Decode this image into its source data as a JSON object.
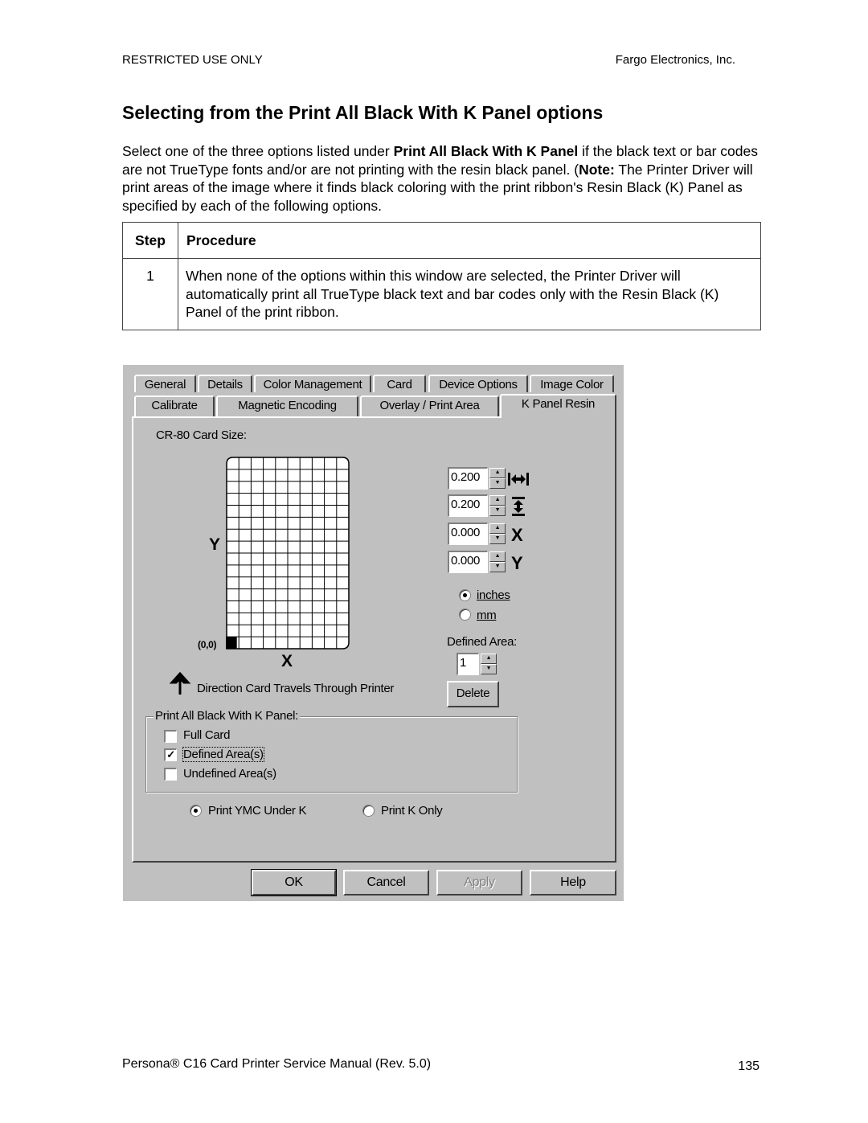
{
  "header": {
    "left": "RESTRICTED USE ONLY",
    "right": "Fargo Electronics, Inc."
  },
  "section_title": "Selecting from the Print All Black With K Panel options",
  "intro": {
    "part1": "Select one of the three options listed under ",
    "bold1": "Print All Black With K Panel",
    "part2": " if the black text or bar codes are not TrueType fonts and/or are not printing with the resin black panel. (",
    "bold2": "Note:",
    "part3": " The Printer Driver will print areas of the image where it finds black coloring with the print ribbon's Resin Black (K) Panel as specified by each of the following options."
  },
  "procedure_table": {
    "columns": [
      "Step",
      "Procedure"
    ],
    "rows": [
      {
        "step": "1",
        "procedure": "When none of the options within this window are selected, the Printer Driver will automatically print all TrueType black text and bar codes only with the Resin Black (K) Panel of the print ribbon."
      }
    ]
  },
  "dialog": {
    "tabs_row1": [
      "General",
      "Details",
      "Color Management",
      "Card",
      "Device Options",
      "Image Color"
    ],
    "tabs_row2": [
      "Calibrate",
      "Magnetic Encoding",
      "Overlay / Print Area",
      "K Panel Resin"
    ],
    "active_tab": "K Panel Resin",
    "card_size_label": "CR-80 Card Size:",
    "grid": {
      "columns": 10,
      "rows": 16
    },
    "axis_y_label": "Y",
    "axis_x_label": "X",
    "origin_label": "(0,0)",
    "direction_label": "Direction Card Travels Through Printer",
    "spinners": [
      {
        "name": "width",
        "value": "0.200",
        "icon": "width-arrows-icon"
      },
      {
        "name": "height",
        "value": "0.200",
        "icon": "height-arrows-icon"
      },
      {
        "name": "x",
        "value": "0.000",
        "icon": "x-icon"
      },
      {
        "name": "y",
        "value": "0.000",
        "icon": "y-icon"
      }
    ],
    "spinner_icon_glyphs": {
      "x": "X",
      "y": "Y"
    },
    "units": {
      "options": [
        "inches",
        "mm"
      ],
      "selected": "inches"
    },
    "defined_area_label": "Defined Area:",
    "defined_area_value": "1",
    "delete_label": "Delete",
    "group_title": "Print All Black With K Panel:",
    "checkboxes": [
      {
        "label": "Full Card",
        "checked": false
      },
      {
        "label": "Defined Area(s)",
        "checked": true
      },
      {
        "label": "Undefined Area(s)",
        "checked": false
      }
    ],
    "print_mode": {
      "options": [
        "Print YMC Under K",
        "Print K Only"
      ],
      "selected": "Print YMC Under K"
    },
    "buttons": {
      "ok": "OK",
      "cancel": "Cancel",
      "apply": "Apply",
      "help": "Help"
    },
    "check_glyph": "✓"
  },
  "footer": {
    "left": "Persona® C16 Card Printer Service Manual (Rev. 5.0)",
    "page_number": "135"
  }
}
